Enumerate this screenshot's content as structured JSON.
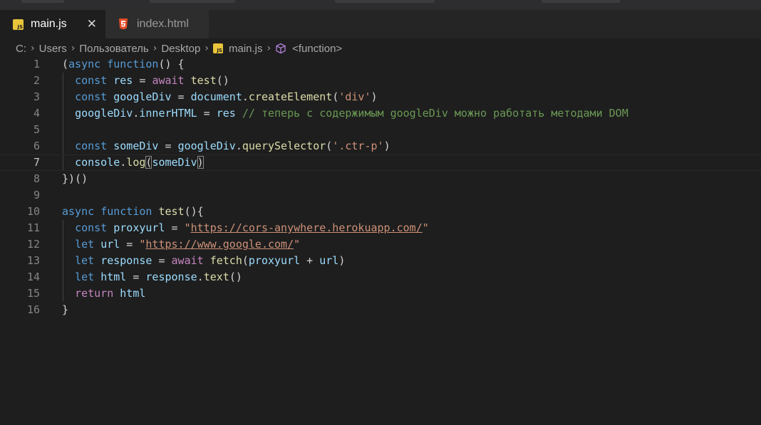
{
  "tabs": [
    {
      "label": "main.js",
      "icon": "js-file-icon",
      "active": true
    },
    {
      "label": "index.html",
      "icon": "html5-file-icon",
      "active": false
    }
  ],
  "breadcrumb": {
    "items": [
      "C:",
      "Users",
      "Пользователь",
      "Desktop",
      "main.js",
      "<function>"
    ]
  },
  "editor": {
    "language": "javascript",
    "current_line": 7,
    "lines": [
      {
        "n": "1",
        "tokens": [
          {
            "t": "(",
            "c": "pl"
          },
          {
            "t": "async",
            "c": "kw"
          },
          {
            "t": " ",
            "c": "pl"
          },
          {
            "t": "function",
            "c": "kw"
          },
          {
            "t": "() {",
            "c": "pl"
          }
        ]
      },
      {
        "n": "2",
        "tokens": [
          {
            "t": "  ",
            "c": "pl"
          },
          {
            "t": "const",
            "c": "kw"
          },
          {
            "t": " ",
            "c": "pl"
          },
          {
            "t": "res",
            "c": "vr"
          },
          {
            "t": " = ",
            "c": "pl"
          },
          {
            "t": "await",
            "c": "ctl"
          },
          {
            "t": " ",
            "c": "pl"
          },
          {
            "t": "test",
            "c": "fn"
          },
          {
            "t": "()",
            "c": "pl"
          }
        ]
      },
      {
        "n": "3",
        "tokens": [
          {
            "t": "  ",
            "c": "pl"
          },
          {
            "t": "const",
            "c": "kw"
          },
          {
            "t": " ",
            "c": "pl"
          },
          {
            "t": "googleDiv",
            "c": "vr"
          },
          {
            "t": " = ",
            "c": "pl"
          },
          {
            "t": "document",
            "c": "vr"
          },
          {
            "t": ".",
            "c": "pl"
          },
          {
            "t": "createElement",
            "c": "fn"
          },
          {
            "t": "(",
            "c": "pl"
          },
          {
            "t": "'div'",
            "c": "str"
          },
          {
            "t": ")",
            "c": "pl"
          }
        ]
      },
      {
        "n": "4",
        "tokens": [
          {
            "t": "  ",
            "c": "pl"
          },
          {
            "t": "googleDiv",
            "c": "vr"
          },
          {
            "t": ".",
            "c": "pl"
          },
          {
            "t": "innerHTML",
            "c": "vr"
          },
          {
            "t": " = ",
            "c": "pl"
          },
          {
            "t": "res",
            "c": "vr"
          },
          {
            "t": " ",
            "c": "pl"
          },
          {
            "t": "// теперь с содержимым googleDiv можно работать методами DOM",
            "c": "cm"
          }
        ]
      },
      {
        "n": "5",
        "tokens": []
      },
      {
        "n": "6",
        "tokens": [
          {
            "t": "  ",
            "c": "pl"
          },
          {
            "t": "const",
            "c": "kw"
          },
          {
            "t": " ",
            "c": "pl"
          },
          {
            "t": "someDiv",
            "c": "vr"
          },
          {
            "t": " = ",
            "c": "pl"
          },
          {
            "t": "googleDiv",
            "c": "vr"
          },
          {
            "t": ".",
            "c": "pl"
          },
          {
            "t": "querySelector",
            "c": "fn"
          },
          {
            "t": "(",
            "c": "pl"
          },
          {
            "t": "'.ctr-p'",
            "c": "str"
          },
          {
            "t": ")",
            "c": "pl"
          }
        ]
      },
      {
        "n": "7",
        "tokens": [
          {
            "t": "  ",
            "c": "pl"
          },
          {
            "t": "console",
            "c": "vr"
          },
          {
            "t": ".",
            "c": "pl"
          },
          {
            "t": "log",
            "c": "fn"
          },
          {
            "t": "(",
            "c": "pl",
            "b": true
          },
          {
            "t": "someDiv",
            "c": "vr"
          },
          {
            "t": ")",
            "c": "pl",
            "b": true
          }
        ]
      },
      {
        "n": "8",
        "tokens": [
          {
            "t": "})()",
            "c": "pl"
          }
        ]
      },
      {
        "n": "9",
        "tokens": []
      },
      {
        "n": "10",
        "tokens": [
          {
            "t": "async",
            "c": "kw"
          },
          {
            "t": " ",
            "c": "pl"
          },
          {
            "t": "function",
            "c": "kw"
          },
          {
            "t": " ",
            "c": "pl"
          },
          {
            "t": "test",
            "c": "fn"
          },
          {
            "t": "(){",
            "c": "pl"
          }
        ]
      },
      {
        "n": "11",
        "tokens": [
          {
            "t": "  ",
            "c": "pl"
          },
          {
            "t": "const",
            "c": "kw"
          },
          {
            "t": " ",
            "c": "pl"
          },
          {
            "t": "proxyurl",
            "c": "vr"
          },
          {
            "t": " = ",
            "c": "pl"
          },
          {
            "t": "\"",
            "c": "str"
          },
          {
            "t": "https://cors-anywhere.herokuapp.com/",
            "c": "str",
            "u": true
          },
          {
            "t": "\"",
            "c": "str"
          }
        ]
      },
      {
        "n": "12",
        "tokens": [
          {
            "t": "  ",
            "c": "pl"
          },
          {
            "t": "let",
            "c": "kw"
          },
          {
            "t": " ",
            "c": "pl"
          },
          {
            "t": "url",
            "c": "vr"
          },
          {
            "t": " = ",
            "c": "pl"
          },
          {
            "t": "\"",
            "c": "str"
          },
          {
            "t": "https://www.google.com/",
            "c": "str",
            "u": true
          },
          {
            "t": "\"",
            "c": "str"
          }
        ]
      },
      {
        "n": "13",
        "tokens": [
          {
            "t": "  ",
            "c": "pl"
          },
          {
            "t": "let",
            "c": "kw"
          },
          {
            "t": " ",
            "c": "pl"
          },
          {
            "t": "response",
            "c": "vr"
          },
          {
            "t": " = ",
            "c": "pl"
          },
          {
            "t": "await",
            "c": "ctl"
          },
          {
            "t": " ",
            "c": "pl"
          },
          {
            "t": "fetch",
            "c": "fn"
          },
          {
            "t": "(",
            "c": "pl"
          },
          {
            "t": "proxyurl",
            "c": "vr"
          },
          {
            "t": " + ",
            "c": "pl"
          },
          {
            "t": "url",
            "c": "vr"
          },
          {
            "t": ")",
            "c": "pl"
          }
        ]
      },
      {
        "n": "14",
        "tokens": [
          {
            "t": "  ",
            "c": "pl"
          },
          {
            "t": "let",
            "c": "kw"
          },
          {
            "t": " ",
            "c": "pl"
          },
          {
            "t": "html",
            "c": "vr"
          },
          {
            "t": " = ",
            "c": "pl"
          },
          {
            "t": "response",
            "c": "vr"
          },
          {
            "t": ".",
            "c": "pl"
          },
          {
            "t": "text",
            "c": "fn"
          },
          {
            "t": "()",
            "c": "pl"
          }
        ]
      },
      {
        "n": "15",
        "tokens": [
          {
            "t": "  ",
            "c": "pl"
          },
          {
            "t": "return",
            "c": "ctl"
          },
          {
            "t": " ",
            "c": "pl"
          },
          {
            "t": "html",
            "c": "vr"
          }
        ]
      },
      {
        "n": "16",
        "tokens": [
          {
            "t": "}",
            "c": "pl"
          }
        ]
      }
    ]
  },
  "colors": {
    "editor_bg": "#1e1e1e",
    "tabbar_bg": "#252526",
    "keyword": "#569cd6",
    "control": "#c586c0",
    "variable": "#9cdcfe",
    "function": "#dcdcaa",
    "string": "#ce9178",
    "comment": "#6a9955",
    "js_icon": "#e8c43a",
    "html_icon": "#e44d26"
  }
}
